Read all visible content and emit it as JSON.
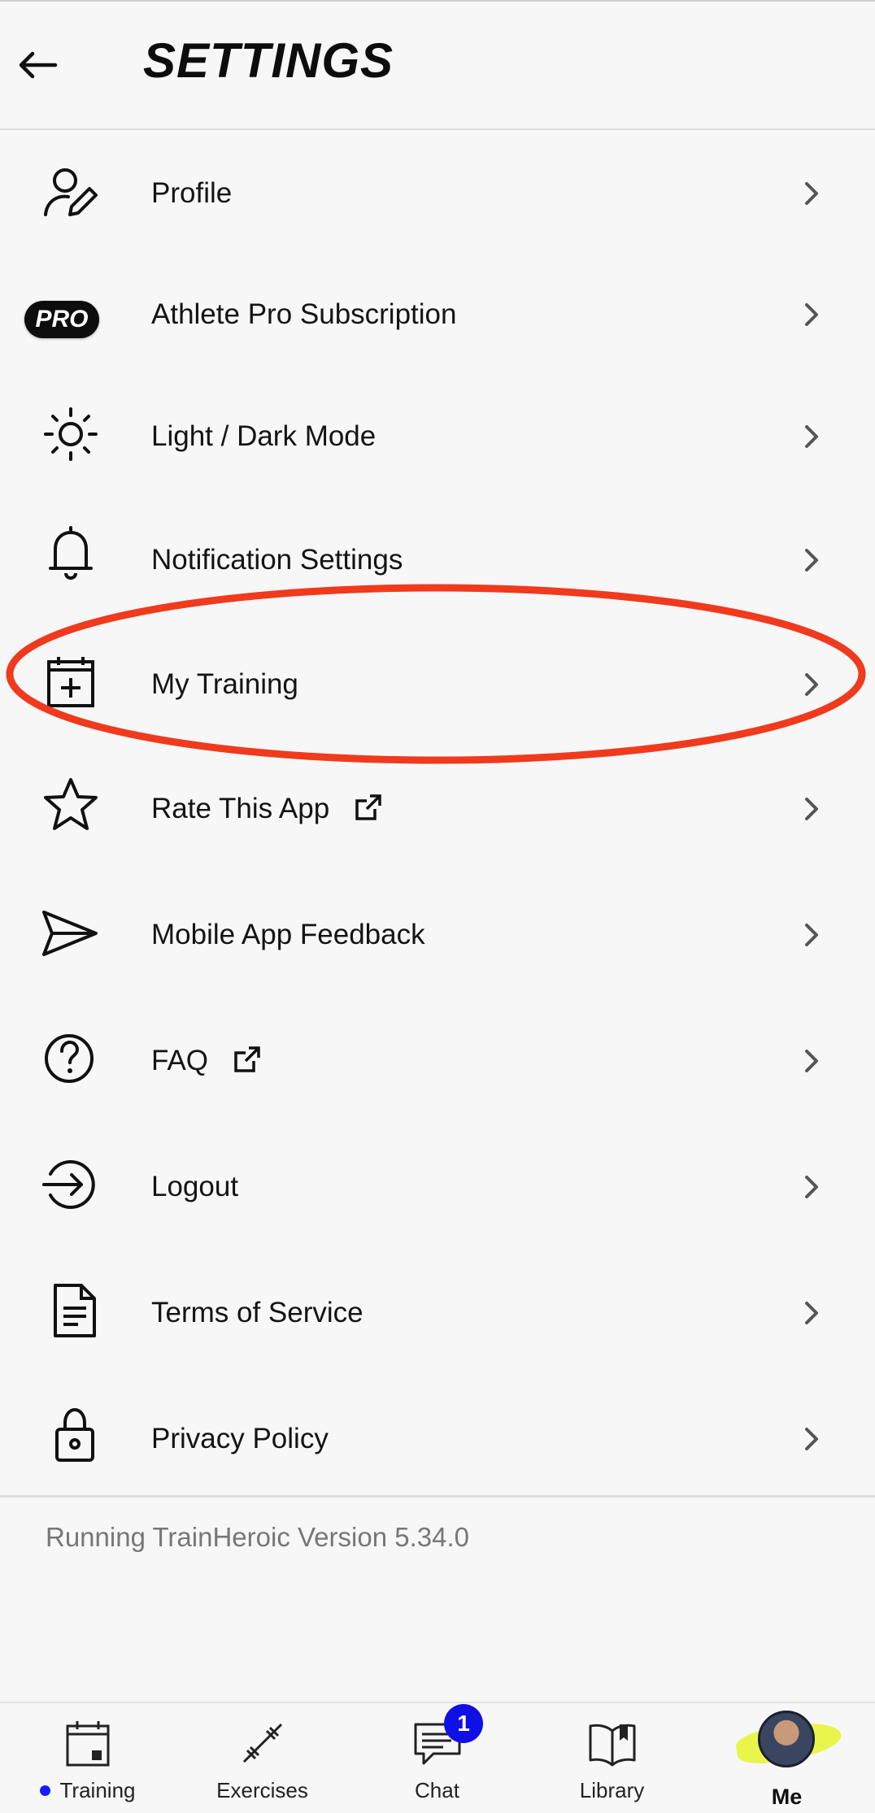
{
  "header": {
    "title": "SETTINGS"
  },
  "menu": [
    {
      "label": "Profile"
    },
    {
      "label": "Athlete Pro Subscription",
      "badge": "PRO"
    },
    {
      "label": "Light / Dark Mode"
    },
    {
      "label": "Notification Settings"
    },
    {
      "label": "My Training"
    },
    {
      "label": "Rate This App"
    },
    {
      "label": "Mobile App Feedback"
    },
    {
      "label": "FAQ"
    },
    {
      "label": "Logout"
    },
    {
      "label": "Terms of Service"
    },
    {
      "label": "Privacy Policy"
    }
  ],
  "version_text": "Running TrainHeroic Version 5.34.0",
  "annotation_color": "#f03a1e",
  "bottom_nav": {
    "items": [
      {
        "label": "Training"
      },
      {
        "label": "Exercises"
      },
      {
        "label": "Chat",
        "badge": "1"
      },
      {
        "label": "Library"
      },
      {
        "label": "Me"
      }
    ]
  }
}
